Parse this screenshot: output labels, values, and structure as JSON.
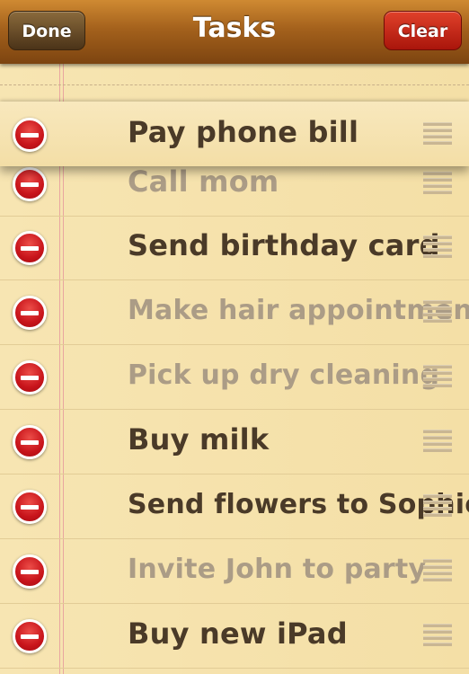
{
  "nav": {
    "title": "Tasks",
    "done_label": "Done",
    "clear_label": "Clear"
  },
  "tasks": [
    {
      "label": "Pay phone bill",
      "completed": false
    },
    {
      "label": "Call mom",
      "completed": true
    },
    {
      "label": "Send birthday card",
      "completed": false
    },
    {
      "label": "Make hair appointment",
      "completed": true
    },
    {
      "label": "Pick up dry cleaning",
      "completed": true
    },
    {
      "label": "Buy milk",
      "completed": false
    },
    {
      "label": "Send flowers to Sophie",
      "completed": false
    },
    {
      "label": "Invite John to party",
      "completed": true
    },
    {
      "label": "Buy new iPad",
      "completed": false
    }
  ],
  "colors": {
    "open_text": "#4a3a28",
    "done_text": "#ab9c86",
    "delete": "#c8141b",
    "nav": "#a4611c"
  }
}
